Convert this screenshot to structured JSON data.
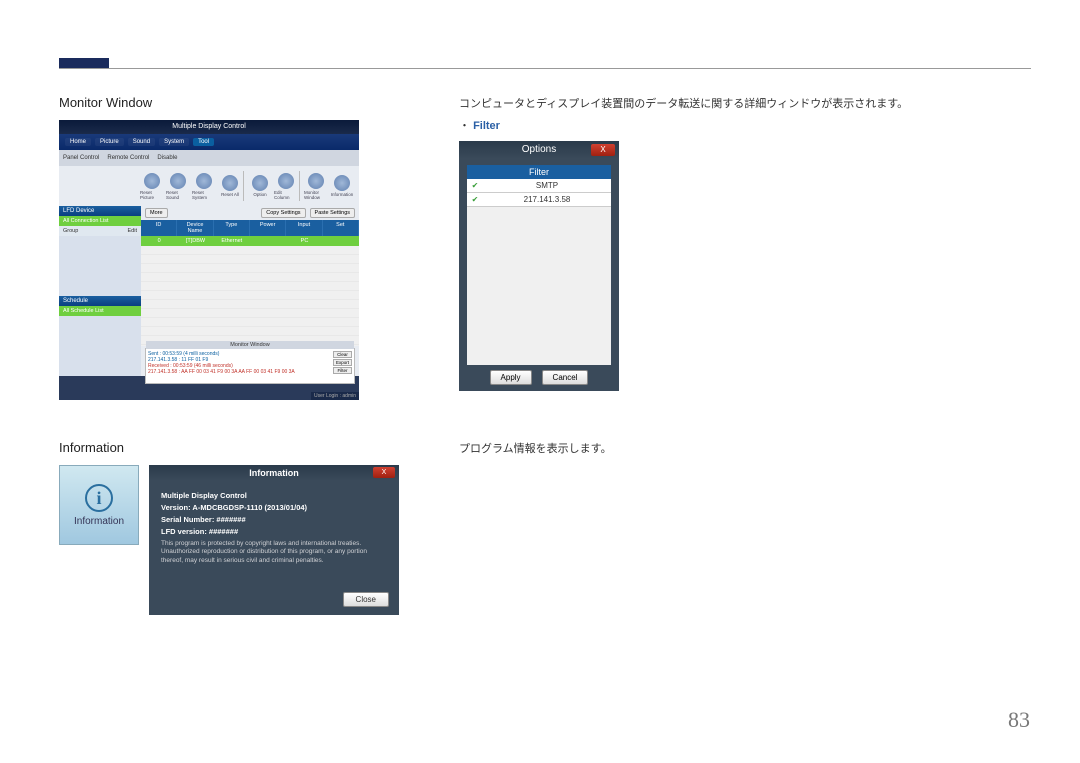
{
  "page_number": "83",
  "sections": {
    "monitor": {
      "title": "Monitor Window",
      "desc": "コンピュータとディスプレイ装置間のデータ転送に関する詳細ウィンドウが表示されます。",
      "filter_label": "Filter"
    },
    "information": {
      "title": "Information",
      "desc": "プログラム情報を表示します。"
    }
  },
  "mdc": {
    "title": "Multiple Display Control",
    "menu": [
      "Home",
      "Picture",
      "Sound",
      "System",
      "Tool"
    ],
    "opt_panel": "Panel Control",
    "opt_remote": "Remote Control",
    "opt_disable": "Disable",
    "icons": [
      "Reset Picture",
      "Reset Sound",
      "Reset System",
      "Reset All",
      "Option",
      "Edit Column",
      "Monitor Window",
      "Information"
    ],
    "toolbar": {
      "more": "More",
      "copy": "Copy Settings",
      "paste": "Paste Settings"
    },
    "side": {
      "lfd": "LFD Device",
      "all_conn": "All Connection List",
      "group": "Group",
      "edit": "Edit",
      "schedule": "Schedule",
      "all_sched": "All Schedule List"
    },
    "table": {
      "headers": [
        "ID",
        "Device Name",
        "Type",
        "Power",
        "Input",
        "Set"
      ],
      "row": [
        "0",
        "[T]DBW",
        "Ethernet",
        "",
        "PC",
        ""
      ]
    },
    "monitorwin": {
      "title": "Monitor Window",
      "sent": "Sent : 00:53:59 (4 milli seconds)",
      "sent2": "217.141.3.58 : 11 FF 01 F9",
      "recv": "Received : 00:53:59 (46 milli seconds)",
      "recv2": "217.141.3.58 : AA FF 00 03 41 F9 00 3A AA FF 00 03 41 F9 00 3A",
      "btns": {
        "clear": "Clear",
        "export": "Export",
        "filter": "Filter"
      }
    },
    "footer": "User Login : admin"
  },
  "options_dialog": {
    "title": "Options",
    "header": "Filter",
    "rows": [
      "SMTP",
      "217.141.3.58"
    ],
    "apply": "Apply",
    "cancel": "Cancel"
  },
  "info_tile": {
    "label": "Information"
  },
  "info_dialog": {
    "title": "Information",
    "prog": "Multiple Display Control",
    "version": "Version: A-MDCBGDSP-1110 (2013/01/04)",
    "serial": "Serial Number: #######",
    "lfd": "LFD version: #######",
    "notice": "This program is protected by copyright laws and international treaties. Unauthorized reproduction or distribution of this program, or any portion thereof, may result in serious civil and criminal penalties.",
    "close": "Close"
  }
}
